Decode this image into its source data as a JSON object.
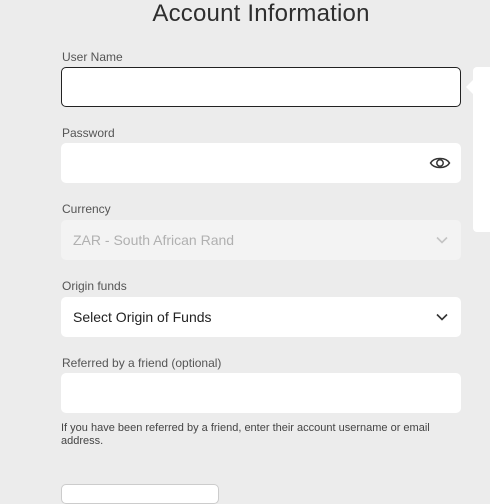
{
  "page": {
    "title": "Account Information"
  },
  "username": {
    "label": "User Name",
    "value": ""
  },
  "password": {
    "label": "Password",
    "value": "",
    "icon": "eye-icon"
  },
  "currency": {
    "label": "Currency",
    "value": "ZAR - South African Rand",
    "disabled": true
  },
  "origin": {
    "label": "Origin funds",
    "value": "Select Origin of Funds"
  },
  "referral": {
    "label": "Referred by a friend (optional)",
    "value": "",
    "help": "If you have been referred by a friend, enter their account username or email address."
  },
  "colors": {
    "background": "#ececec",
    "field": "#ffffff",
    "focus_border": "#222222"
  }
}
